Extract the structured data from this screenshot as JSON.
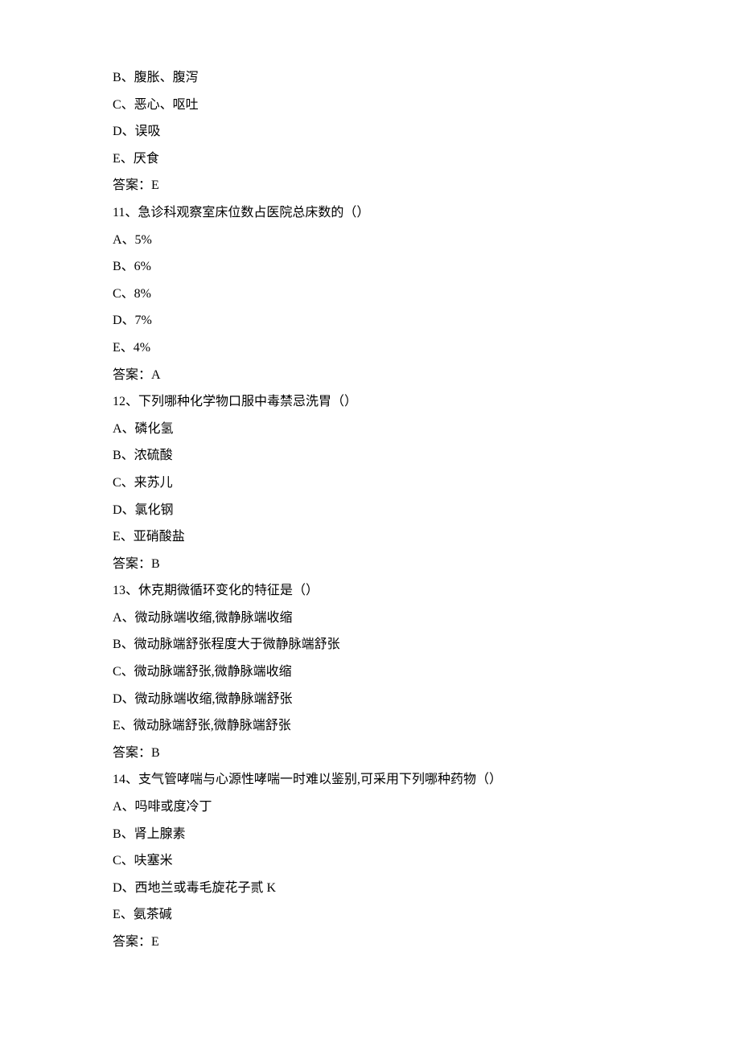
{
  "lines": [
    "B、腹胀、腹泻",
    "C、恶心、呕吐",
    "D、误吸",
    "E、厌食",
    "答案：E",
    "11、急诊科观察室床位数占医院总床数的（）",
    "A、5%",
    "B、6%",
    "C、8%",
    "D、7%",
    "E、4%",
    "答案：A",
    "12、下列哪种化学物口服中毒禁忌洗胃（）",
    "A、磷化氢",
    "B、浓硫酸",
    "C、来苏儿",
    "D、氯化钢",
    "E、亚硝酸盐",
    "答案：B",
    "13、休克期微循环变化的特征是（）",
    "A、微动脉端收缩,微静脉端收缩",
    "B、微动脉端舒张程度大于微静脉端舒张",
    "C、微动脉端舒张,微静脉端收缩",
    "D、微动脉端收缩,微静脉端舒张",
    "E、微动脉端舒张,微静脉端舒张",
    "答案：B",
    "14、支气管哮喘与心源性哮喘一时难以鉴别,可采用下列哪种药物（）",
    "A、吗啡或度冷丁",
    "B、肾上腺素",
    "C、呋塞米",
    "D、西地兰或毒毛旋花子贰 K",
    "E、氨茶碱",
    "答案：E"
  ]
}
